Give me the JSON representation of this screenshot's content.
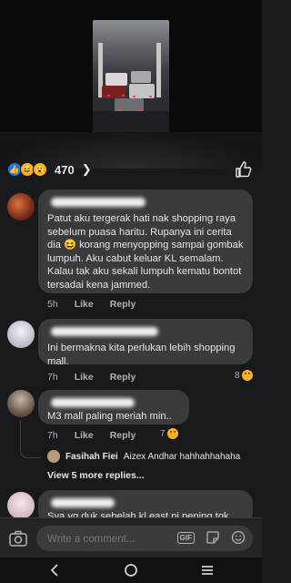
{
  "reactions": {
    "count": "470",
    "types": [
      "like-icon",
      "haha-icon",
      "wow-icon"
    ]
  },
  "comments": [
    {
      "text": "Patut aku tergerak hati nak shopping raya sebelum puasa haritu. Rupanya ini cerita dia 😆 korang menyopping sampai gombak lumpuh. Aku cabut keluar KL semalam. Kalau tak aku sekali lumpuh kematu bontot tersadai kena jammed.",
      "time": "5h",
      "like": "Like",
      "reply": "Reply"
    },
    {
      "text": "Ini bermakna kita perlukan lebih shopping mall.",
      "time": "7h",
      "like": "Like",
      "reply": "Reply",
      "reaction_count": "8"
    },
    {
      "text": "M3 mall paling meriah min..",
      "time": "7h",
      "like": "Like",
      "reply": "Reply",
      "reaction_count": "7"
    },
    {
      "text": "Sya yg duk sebelah kl east ni pening tgk"
    }
  ],
  "reply": {
    "name": "Fasihah Fiei",
    "text": "Aizex Andhar hahhahhahaha"
  },
  "view_more": "View 5 more replies...",
  "composer": {
    "placeholder": "Write a comment...",
    "gif": "GIF"
  },
  "colors": {
    "background": "#18191a",
    "bubble": "#3a3b3c",
    "accent": "#1877f2"
  }
}
